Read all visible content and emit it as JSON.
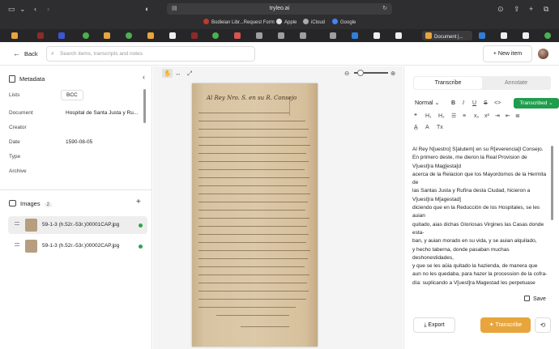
{
  "browser": {
    "url": "tryleo.ai",
    "favorites": [
      "Bodleian Libr...Request Form",
      "Apple",
      "iCloud",
      "Google"
    ],
    "active_tab": "Document |..."
  },
  "header": {
    "back_label": "Back",
    "search_placeholder": "Search items, transcripts and notes",
    "new_item_label": "+ New item"
  },
  "metadata": {
    "title": "Metadata",
    "rows": [
      {
        "label": "Lists",
        "value": "BCC"
      },
      {
        "label": "Document",
        "value": "Hospital de Santa Justa y Ru..."
      },
      {
        "label": "Creator",
        "value": ""
      },
      {
        "label": "Date",
        "value": "1590-08-05"
      },
      {
        "label": "Type",
        "value": ""
      },
      {
        "label": "Archive",
        "value": ""
      }
    ]
  },
  "images": {
    "title": "Images",
    "count": "2",
    "items": [
      {
        "name": "59-1-3 (h.52r.-53r.)00001CAP.jpg",
        "selected": true
      },
      {
        "name": "59-1-3 (h.52r.-53r.)00002CAP.jpg",
        "selected": false
      }
    ]
  },
  "viewer": {
    "page_heading": "Al Rey Nro. S. en su R. Consejo"
  },
  "editor": {
    "tab_transcribe": "Transcribe",
    "tab_annotate": "Annotate",
    "style": "Normal",
    "status": "Transcribed",
    "lines": [
      "Al Rey N[uestro] S[alutem] en su R[everencia]l Consejo.",
      "En primero deste, me dieron la Real Provision de",
      "V[uest]ra Mag[esta]d",
      "acerca de la Relacion que los Mayordomos de la Hermita",
      "de",
      "las Santas Justa y Rufina desta Ciudad, hicieron a",
      "V[uest]ra M[agestad]",
      "diciendo que en la Reducción de los Hospitales, se les",
      "auian",
      "quitado, aias dichas Gloriosas Virgines las Casas donde",
      "esta-",
      "ban, y auian morado en su vida, y se auian alquilado,",
      "y hecho taberna, donde pasaban muchas",
      "deshonestidades,",
      "y que se les aüia quitado la hazienda, de manera que",
      "aun no les quedaba, para hazer la procession de la cofra-",
      "día: suplicando a V[uest]ra Magestad les perpetuase"
    ],
    "save_label": "Save",
    "export_label": "Export",
    "transcribe_label": "Transcribe"
  }
}
